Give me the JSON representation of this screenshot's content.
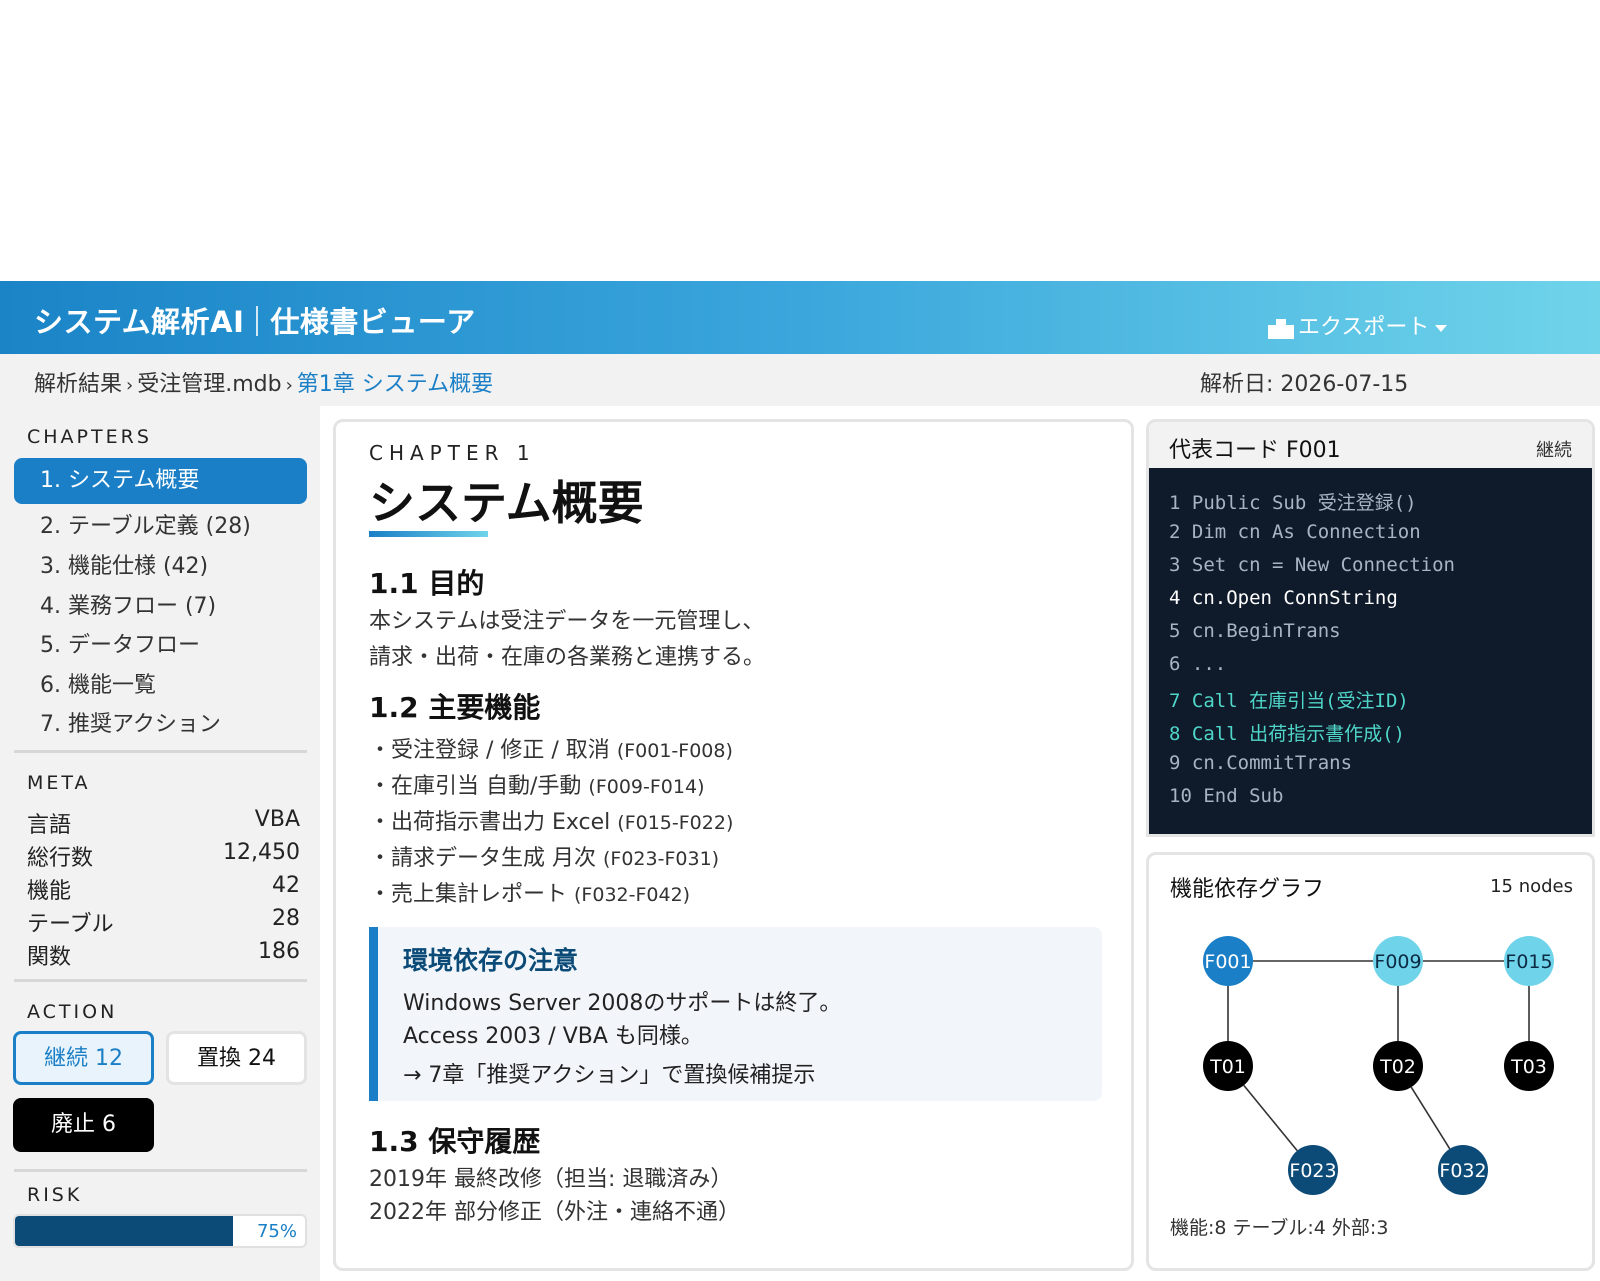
{
  "header": {
    "app_name": "システム解析AI",
    "viewer_name": "仕様書ビューア",
    "export_label": "エクスポート"
  },
  "breadcrumb": {
    "items": [
      "解析結果",
      "受注管理.mdb",
      "第1章 システム概要"
    ],
    "date_label": "解析日: 2026-07-15"
  },
  "sidebar": {
    "chapters_label": "CHAPTERS",
    "chapters": [
      {
        "label": "1. システム概要",
        "active": true
      },
      {
        "label": "2. テーブル定義 (28)",
        "active": false
      },
      {
        "label": "3. 機能仕様 (42)",
        "active": false
      },
      {
        "label": "4. 業務フロー (7)",
        "active": false
      },
      {
        "label": "5. データフロー",
        "active": false
      },
      {
        "label": "6. 機能一覧",
        "active": false
      },
      {
        "label": "7. 推奨アクション",
        "active": false
      }
    ],
    "meta_label": "META",
    "meta": [
      {
        "key": "言語",
        "value": "VBA"
      },
      {
        "key": "総行数",
        "value": "12,450"
      },
      {
        "key": "機能",
        "value": "42"
      },
      {
        "key": "テーブル",
        "value": "28"
      },
      {
        "key": "関数",
        "value": "186"
      }
    ],
    "action_label": "ACTION",
    "actions": {
      "keep": "継続 12",
      "replace": "置換 24",
      "abolish": "廃止 6"
    },
    "risk_label": "RISK",
    "risk_value": 0.75,
    "risk_text": "75%"
  },
  "main": {
    "kicker": "CHAPTER 1",
    "title": "システム概要",
    "s1_heading": "1.1 目的",
    "s1_lines": [
      "本システムは受注データを一元管理し、",
      "請求・出荷・在庫の各業務と連携する。"
    ],
    "s2_heading": "1.2 主要機能",
    "features": [
      {
        "text": "・受注登録 / 修正 / 取消",
        "code": "(F001-F008)"
      },
      {
        "text": "・在庫引当 自動/手動",
        "code": "(F009-F014)"
      },
      {
        "text": "・出荷指示書出力 Excel",
        "code": "(F015-F022)"
      },
      {
        "text": "・請求データ生成 月次",
        "code": "(F023-F031)"
      },
      {
        "text": "・売上集計レポート",
        "code": "(F032-F042)"
      }
    ],
    "note": {
      "title": "環境依存の注意",
      "lines": [
        "Windows Server 2008のサポートは終了。",
        "Access 2003 / VBA も同様。",
        "→ 7章「推奨アクション」で置換候補提示"
      ]
    },
    "s3_heading": "1.3 保守履歴",
    "s3_lines": [
      "2019年 最終改修（担当: 退職済み）",
      "2022年 部分修正（外注・連絡不通）"
    ]
  },
  "code_panel": {
    "title": "代表コード F001",
    "status": "継続",
    "lines": [
      {
        "text": "1 Public Sub 受注登録()",
        "style": "dim"
      },
      {
        "text": "2 Dim cn As Connection",
        "style": "dim"
      },
      {
        "text": "3 Set cn = New Connection",
        "style": "dim"
      },
      {
        "text": "4 cn.Open ConnString",
        "style": "bright"
      },
      {
        "text": "5 cn.BeginTrans",
        "style": "dim"
      },
      {
        "text": "6 ...",
        "style": "dim"
      },
      {
        "text": "7 Call 在庫引当(受注ID)",
        "style": "accent"
      },
      {
        "text": "8 Call 出荷指示書作成()",
        "style": "accent"
      },
      {
        "text": "9 cn.CommitTrans",
        "style": "dim"
      },
      {
        "text": "10 End Sub",
        "style": "dim"
      }
    ]
  },
  "graph": {
    "title": "機能依存グラフ",
    "count": "15 nodes",
    "legend": "機能:8 テーブル:4 外部:3",
    "nodes": [
      {
        "id": "F001",
        "color": "#1a7fc6",
        "text_color": "#ffffff"
      },
      {
        "id": "F009",
        "color": "#6fd4ea",
        "text_color": "#0c2a44"
      },
      {
        "id": "F015",
        "color": "#6fd4ea",
        "text_color": "#0c2a44"
      },
      {
        "id": "T01",
        "color": "#000000",
        "text_color": "#ffffff"
      },
      {
        "id": "T02",
        "color": "#000000",
        "text_color": "#ffffff"
      },
      {
        "id": "T03",
        "color": "#000000",
        "text_color": "#ffffff"
      },
      {
        "id": "F023",
        "color": "#0c4b78",
        "text_color": "#ffffff"
      },
      {
        "id": "F032",
        "color": "#0c4b78",
        "text_color": "#ffffff"
      }
    ],
    "edges": [
      [
        "F001",
        "F009"
      ],
      [
        "F009",
        "F015"
      ],
      [
        "F001",
        "T01"
      ],
      [
        "F009",
        "T02"
      ],
      [
        "F015",
        "T03"
      ],
      [
        "T01",
        "F023"
      ],
      [
        "T02",
        "F032"
      ]
    ]
  },
  "colors": {
    "primary": "#1a7fc6",
    "dark_blue": "#0c4b78",
    "cyan": "#6fd4ea",
    "code_bg": "#0f1a2b",
    "code_accent": "#4fd6c8"
  }
}
